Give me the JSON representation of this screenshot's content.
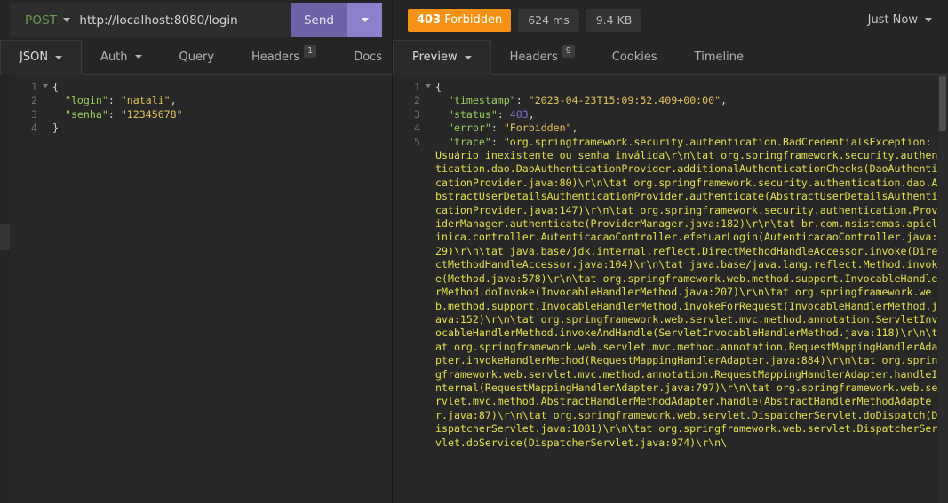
{
  "request_bar": {
    "method": "POST",
    "method_caret_icon": "chevron-down-icon",
    "url": "http://localhost:8080/login",
    "send_label": "Send",
    "send_caret_icon": "chevron-down-icon"
  },
  "response_bar": {
    "status_code": "403",
    "status_text": "Forbidden",
    "status_color": "#f59215",
    "time": "624 ms",
    "size": "9.4 KB",
    "history_label": "Just Now",
    "history_caret_icon": "chevron-down-icon"
  },
  "request_tabs": [
    {
      "label": "JSON",
      "active": true,
      "caret": true,
      "badge": null
    },
    {
      "label": "Auth",
      "active": false,
      "caret": true,
      "badge": null
    },
    {
      "label": "Query",
      "active": false,
      "caret": false,
      "badge": null
    },
    {
      "label": "Headers",
      "active": false,
      "caret": false,
      "badge": "1"
    },
    {
      "label": "Docs",
      "active": false,
      "caret": false,
      "badge": null
    }
  ],
  "response_tabs": [
    {
      "label": "Preview",
      "active": true,
      "caret": true,
      "badge": null
    },
    {
      "label": "Headers",
      "active": false,
      "caret": false,
      "badge": "9"
    },
    {
      "label": "Cookies",
      "active": false,
      "caret": false,
      "badge": null
    },
    {
      "label": "Timeline",
      "active": false,
      "caret": false,
      "badge": null
    }
  ],
  "request_editor": {
    "line_numbers": [
      "1",
      "2",
      "3",
      "4"
    ],
    "lines": [
      {
        "segments": [
          {
            "t": "{",
            "c": "p"
          }
        ]
      },
      {
        "segments": [
          {
            "t": "  ",
            "c": "p"
          },
          {
            "t": "\"login\"",
            "c": "k"
          },
          {
            "t": ": ",
            "c": "p"
          },
          {
            "t": "\"natali\"",
            "c": "s"
          },
          {
            "t": ",",
            "c": "p"
          }
        ]
      },
      {
        "segments": [
          {
            "t": "  ",
            "c": "p"
          },
          {
            "t": "\"senha\"",
            "c": "k"
          },
          {
            "t": ": ",
            "c": "p"
          },
          {
            "t": "\"12345678\"",
            "c": "s"
          }
        ]
      },
      {
        "segments": [
          {
            "t": "}",
            "c": "p"
          }
        ]
      }
    ]
  },
  "response_editor": {
    "line_numbers": [
      "1",
      "2",
      "3",
      "4",
      "5"
    ],
    "lines": [
      {
        "segments": [
          {
            "t": "{",
            "c": "p"
          }
        ]
      },
      {
        "segments": [
          {
            "t": "  ",
            "c": "p"
          },
          {
            "t": "\"timestamp\"",
            "c": "k"
          },
          {
            "t": ": ",
            "c": "p"
          },
          {
            "t": "\"2023-04-23T15:09:52.409+00:00\"",
            "c": "s"
          },
          {
            "t": ",",
            "c": "p"
          }
        ]
      },
      {
        "segments": [
          {
            "t": "  ",
            "c": "p"
          },
          {
            "t": "\"status\"",
            "c": "k"
          },
          {
            "t": ": ",
            "c": "p"
          },
          {
            "t": "403",
            "c": "n"
          },
          {
            "t": ",",
            "c": "p"
          }
        ]
      },
      {
        "segments": [
          {
            "t": "  ",
            "c": "p"
          },
          {
            "t": "\"error\"",
            "c": "k"
          },
          {
            "t": ": ",
            "c": "p"
          },
          {
            "t": "\"Forbidden\"",
            "c": "s"
          },
          {
            "t": ",",
            "c": "p"
          }
        ]
      },
      {
        "segments": [
          {
            "t": "  ",
            "c": "p"
          },
          {
            "t": "\"trace\"",
            "c": "k"
          },
          {
            "t": ": ",
            "c": "p"
          },
          {
            "t": "\"org.springframework.security.authentication.BadCredentialsException: Usuário inexistente ou senha inválida\\r\\n\\tat org.springframework.security.authentication.dao.DaoAuthenticationProvider.additionalAuthenticationChecks(DaoAuthenticationProvider.java:80)\\r\\n\\tat org.springframework.security.authentication.dao.AbstractUserDetailsAuthenticationProvider.authenticate(AbstractUserDetailsAuthenticationProvider.java:147)\\r\\n\\tat org.springframework.security.authentication.ProviderManager.authenticate(ProviderManager.java:182)\\r\\n\\tat br.com.nsistemas.apiclinica.controller.AutenticacaoController.efetuarLogin(AutenticacaoController.java:29)\\r\\n\\tat java.base/jdk.internal.reflect.DirectMethodHandleAccessor.invoke(DirectMethodHandleAccessor.java:104)\\r\\n\\tat java.base/java.lang.reflect.Method.invoke(Method.java:578)\\r\\n\\tat org.springframework.web.method.support.InvocableHandlerMethod.doInvoke(InvocableHandlerMethod.java:207)\\r\\n\\tat org.springframework.web.method.support.InvocableHandlerMethod.invokeForRequest(InvocableHandlerMethod.java:152)\\r\\n\\tat org.springframework.web.servlet.mvc.method.annotation.ServletInvocableHandlerMethod.invokeAndHandle(ServletInvocableHandlerMethod.java:118)\\r\\n\\tat org.springframework.web.servlet.mvc.method.annotation.RequestMappingHandlerAdapter.invokeHandlerMethod(RequestMappingHandlerAdapter.java:884)\\r\\n\\tat org.springframework.web.servlet.mvc.method.annotation.RequestMappingHandlerAdapter.handleInternal(RequestMappingHandlerAdapter.java:797)\\r\\n\\tat org.springframework.web.servlet.mvc.method.AbstractHandlerMethodAdapter.handle(AbstractHandlerMethodAdapter.java:87)\\r\\n\\tat org.springframework.web.servlet.DispatcherServlet.doDispatch(DispatcherServlet.java:1081)\\r\\n\\tat org.springframework.web.servlet.DispatcherServlet.doService(DispatcherServlet.java:974)\\r\\n\\",
            "c": "tr"
          }
        ]
      }
    ]
  }
}
